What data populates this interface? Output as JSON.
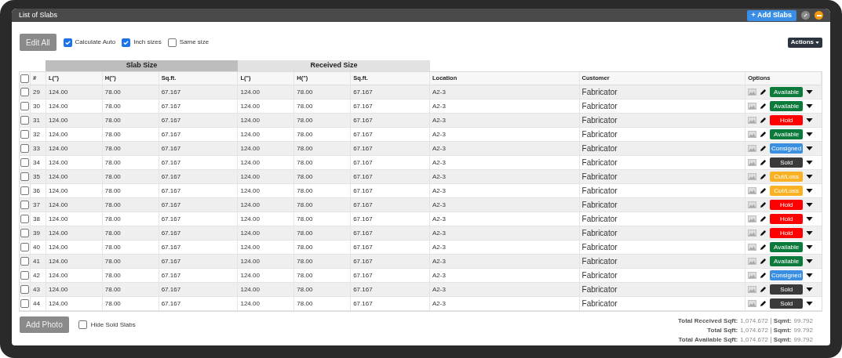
{
  "window": {
    "title": "List of Slabs"
  },
  "header_buttons": {
    "add": "+ Add Slabs"
  },
  "toolbar": {
    "edit_all": "Edit All",
    "options": [
      {
        "label": "Calculate Auto",
        "checked": true
      },
      {
        "label": "Inch sizes",
        "checked": true
      },
      {
        "label": "Same size",
        "checked": false
      }
    ],
    "actions": "Actions"
  },
  "table": {
    "groups": [
      "Slab Size",
      "Received Size"
    ],
    "select_all": {
      "checked": false
    },
    "columns": [
      "#",
      "L(\")",
      "H(\")",
      "Sq.ft.",
      "L(\")",
      "H(\")",
      "Sq.ft.",
      "Location",
      "Customer",
      "Options"
    ],
    "rows": [
      {
        "checked": false,
        "cells": [
          "29",
          "124.00",
          "78.00",
          "67.167",
          "124.00",
          "78.00",
          "67.167",
          "A2-3",
          "Fabricator"
        ],
        "status": "Available",
        "color": "#0b7a3b"
      },
      {
        "checked": false,
        "cells": [
          "30",
          "124.00",
          "78.00",
          "67.167",
          "124.00",
          "78.00",
          "67.167",
          "A2-3",
          "Fabricator"
        ],
        "status": "Available",
        "color": "#0b7a3b"
      },
      {
        "checked": false,
        "cells": [
          "31",
          "124.00",
          "78.00",
          "67.167",
          "124.00",
          "78.00",
          "67.167",
          "A2-3",
          "Fabricator"
        ],
        "status": "Hold",
        "color": "#ff0000"
      },
      {
        "checked": false,
        "cells": [
          "32",
          "124.00",
          "78.00",
          "67.167",
          "124.00",
          "78.00",
          "67.167",
          "A2-3",
          "Fabricator"
        ],
        "status": "Available",
        "color": "#0b7a3b"
      },
      {
        "checked": false,
        "cells": [
          "33",
          "124.00",
          "78.00",
          "67.167",
          "124.00",
          "78.00",
          "67.167",
          "A2-3",
          "Fabricator"
        ],
        "status": "Consigned",
        "color": "#3b8fe0"
      },
      {
        "checked": false,
        "cells": [
          "34",
          "124.00",
          "78.00",
          "67.167",
          "124.00",
          "78.00",
          "67.167",
          "A2-3",
          "Fabricator"
        ],
        "status": "Sold",
        "color": "#3a3a3a"
      },
      {
        "checked": false,
        "cells": [
          "35",
          "124.00",
          "78.00",
          "67.167",
          "124.00",
          "78.00",
          "67.167",
          "A2-3",
          "Fabricator"
        ],
        "status": "Cut/Loss",
        "color": "#fbb124"
      },
      {
        "checked": false,
        "cells": [
          "36",
          "124.00",
          "78.00",
          "67.167",
          "124.00",
          "78.00",
          "67.167",
          "A2-3",
          "Fabricator"
        ],
        "status": "Cut/Loss",
        "color": "#fbb124"
      },
      {
        "checked": false,
        "cells": [
          "37",
          "124.00",
          "78.00",
          "67.167",
          "124.00",
          "78.00",
          "67.167",
          "A2-3",
          "Fabricator"
        ],
        "status": "Hold",
        "color": "#ff0000"
      },
      {
        "checked": false,
        "cells": [
          "38",
          "124.00",
          "78.00",
          "67.167",
          "124.00",
          "78.00",
          "67.167",
          "A2-3",
          "Fabricator"
        ],
        "status": "Hold",
        "color": "#ff0000"
      },
      {
        "checked": false,
        "cells": [
          "39",
          "124.00",
          "78.00",
          "67.167",
          "124.00",
          "78.00",
          "67.167",
          "A2-3",
          "Fabricator"
        ],
        "status": "Hold",
        "color": "#ff0000"
      },
      {
        "checked": false,
        "cells": [
          "40",
          "124.00",
          "78.00",
          "67.167",
          "124.00",
          "78.00",
          "67.167",
          "A2-3",
          "Fabricator"
        ],
        "status": "Available",
        "color": "#0b7a3b"
      },
      {
        "checked": false,
        "cells": [
          "41",
          "124.00",
          "78.00",
          "67.167",
          "124.00",
          "78.00",
          "67.167",
          "A2-3",
          "Fabricator"
        ],
        "status": "Available",
        "color": "#0b7a3b"
      },
      {
        "checked": false,
        "cells": [
          "42",
          "124.00",
          "78.00",
          "67.167",
          "124.00",
          "78.00",
          "67.167",
          "A2-3",
          "Fabricator"
        ],
        "status": "Consigned",
        "color": "#3b8fe0"
      },
      {
        "checked": false,
        "cells": [
          "43",
          "124.00",
          "78.00",
          "67.167",
          "124.00",
          "78.00",
          "67.167",
          "A2-3",
          "Fabricator"
        ],
        "status": "Sold",
        "color": "#3a3a3a"
      },
      {
        "checked": false,
        "cells": [
          "44",
          "124.00",
          "78.00",
          "67.167",
          "124.00",
          "78.00",
          "67.167",
          "A2-3",
          "Fabricator"
        ],
        "status": "Sold",
        "color": "#3a3a3a"
      }
    ]
  },
  "footer": {
    "add_photo": "Add Photo",
    "hide_sold": {
      "label": "Hide Sold Slabs",
      "checked": false
    },
    "totals": [
      {
        "label": "Total Received Sqft:",
        "sqft": "1,074.672",
        "sqmt_label": "Sqmt:",
        "sqmt": "99.792"
      },
      {
        "label": "Total Sqft:",
        "sqft": "1,074.672",
        "sqmt_label": "Sqmt:",
        "sqmt": "99.792"
      },
      {
        "label": "Total Available Sqft:",
        "sqft": "1,074.672",
        "sqmt_label": "Sqmt:",
        "sqmt": "99.792"
      }
    ]
  }
}
